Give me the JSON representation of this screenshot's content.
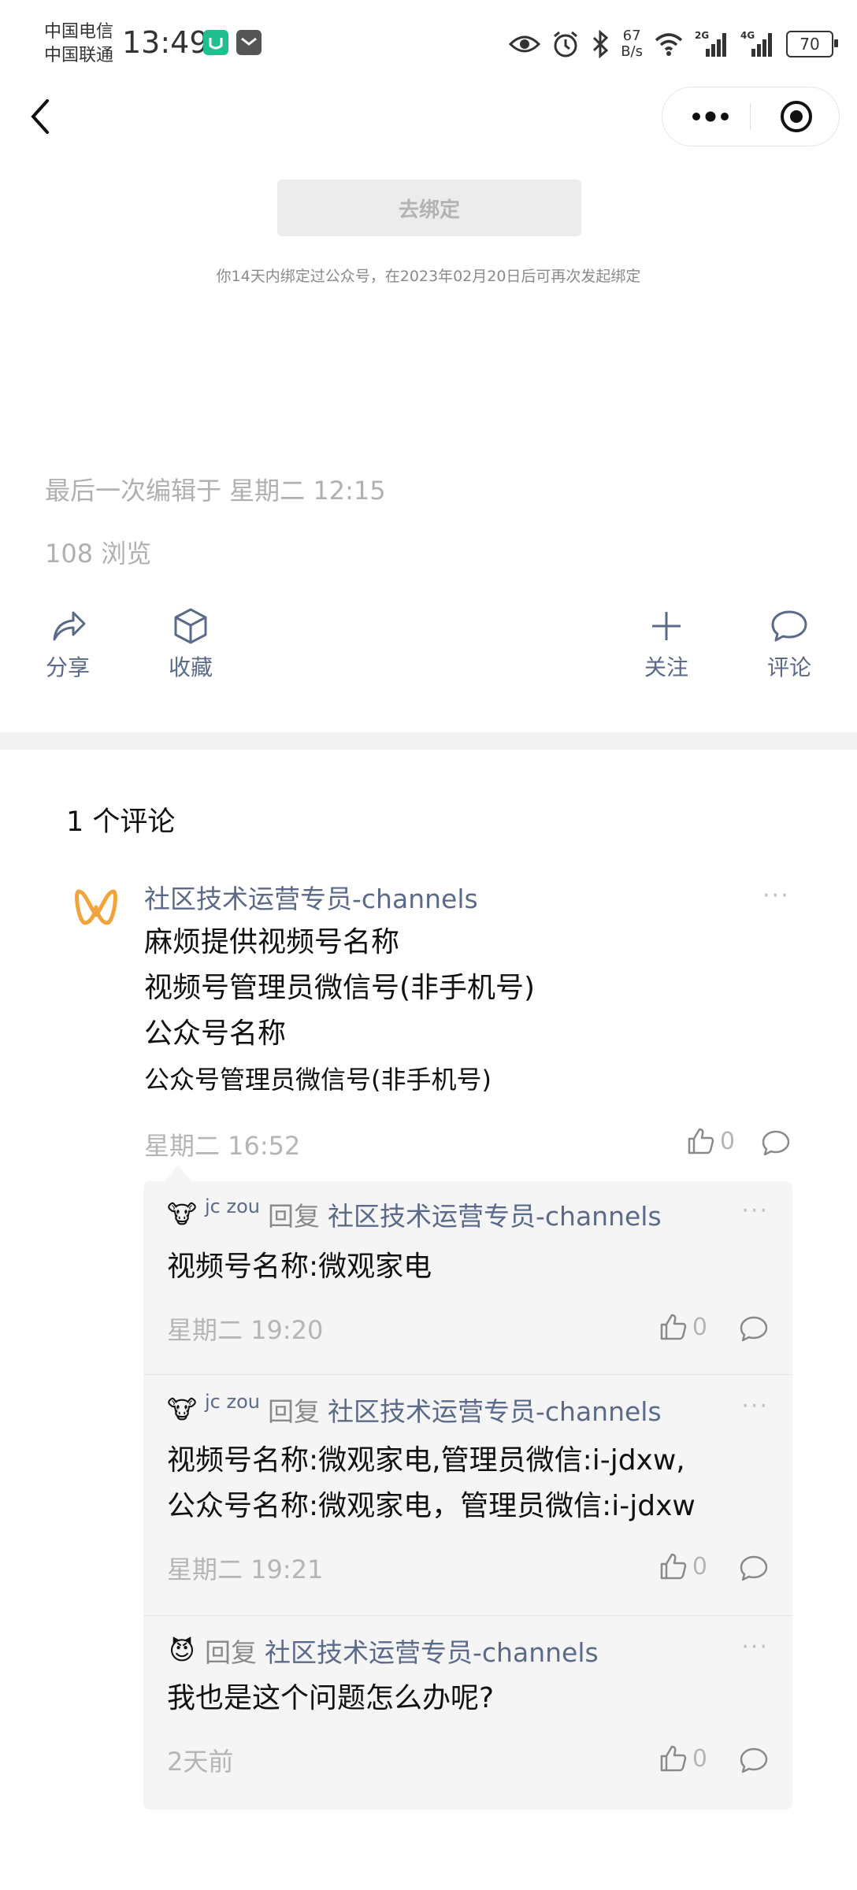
{
  "status_bar": {
    "carrier1": "中国电信",
    "carrier2": "中国联通",
    "time": "13:49",
    "speed_value": "67",
    "speed_unit": "B/s",
    "net1": "2G",
    "net2": "4G",
    "battery": "70"
  },
  "bind": {
    "button_label": "去绑定",
    "note": "你14天内绑定过公众号，在2023年02月20日后可再次发起绑定"
  },
  "meta": {
    "last_edit": "最后一次编辑于 星期二 12:15",
    "views": "108 浏览"
  },
  "actions": {
    "share": "分享",
    "favorite": "收藏",
    "follow": "关注",
    "comment": "评论"
  },
  "comments": {
    "count_label": "1 个评论",
    "main": {
      "author": "社区技术运营专员-channels",
      "line1": "麻烦提供视频号名称",
      "line2": "视频号管理员微信号(非手机号)",
      "line3": "公众号名称",
      "line4": "公众号管理员微信号(非手机号)",
      "time": "星期二 16:52",
      "likes": "0"
    },
    "replies": [
      {
        "user": "jc zou",
        "verb": "回复",
        "target": "社区技术运营专员-channels",
        "text1": "视频号名称:微观家电",
        "time": "星期二 19:20",
        "likes": "0"
      },
      {
        "user": "jc zou",
        "verb": "回复",
        "target": "社区技术运营专员-channels",
        "text1": "视频号名称:微观家电,管理员微信:i-jdxw,",
        "text2": "公众号名称:微观家电，管理员微信:i-jdxw",
        "time": "星期二 19:21",
        "likes": "0"
      },
      {
        "verb": "回复",
        "target": "社区技术运营专员-channels",
        "text1": "我也是这个问题怎么办呢?",
        "time": "2天前",
        "likes": "0"
      }
    ]
  },
  "colors": {
    "link": "#5b6a88",
    "muted": "#b5b5b5"
  }
}
